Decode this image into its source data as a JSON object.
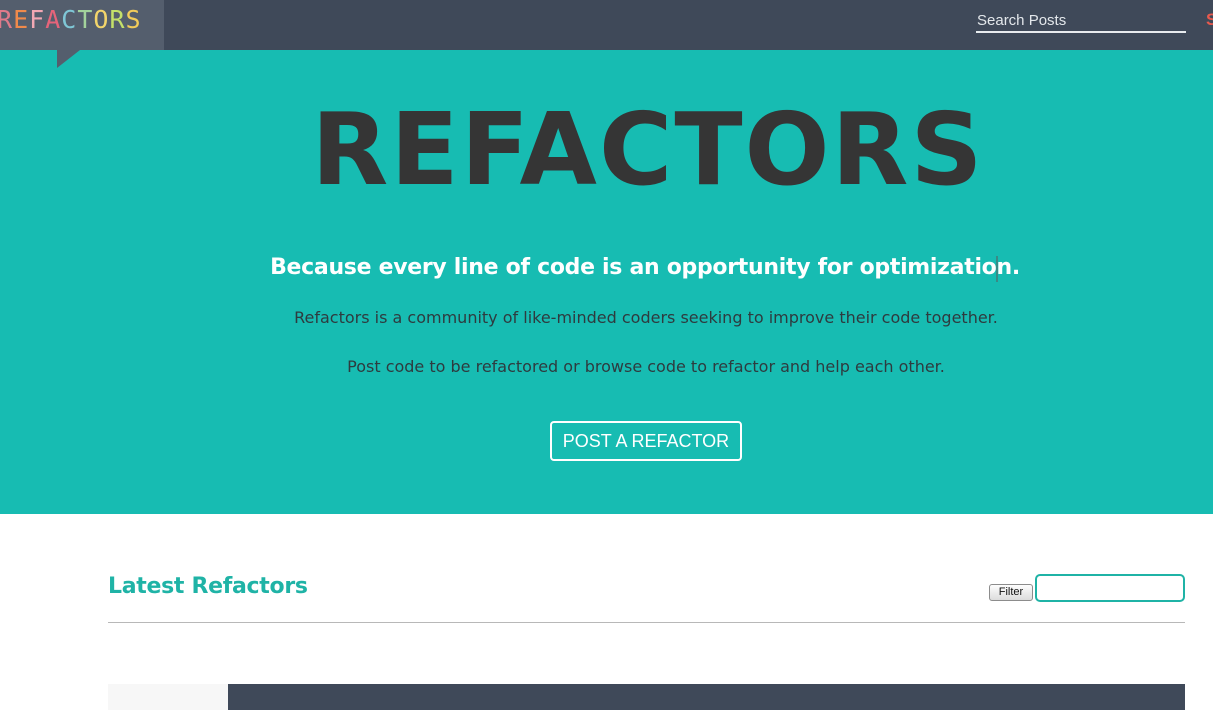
{
  "navbar": {
    "logo_letters": [
      {
        "char": "R",
        "color": "#e07a8a"
      },
      {
        "char": "E",
        "color": "#f08a4b"
      },
      {
        "char": "F",
        "color": "#f2a8b4"
      },
      {
        "char": "A",
        "color": "#e5647a"
      },
      {
        "char": "C",
        "color": "#7fc7d6"
      },
      {
        "char": "T",
        "color": "#a3d39c"
      },
      {
        "char": "O",
        "color": "#f2d56b"
      },
      {
        "char": "R",
        "color": "#c4e06a"
      },
      {
        "char": "S",
        "color": "#f2cc5a"
      }
    ],
    "search_placeholder": "Search Posts",
    "edge_text": "S"
  },
  "hero": {
    "title": "REFACTORS",
    "tagline": "Because every line of code is an opportunity for optimization.",
    "description_1": "Refactors is a community of like-minded coders seeking to improve their code together.",
    "description_2": "Post code to be refactored or browse code to refactor and help each other.",
    "cta_label": "POST A REFACTOR"
  },
  "latest": {
    "title": "Latest Refactors",
    "filter_label": "Filter",
    "filter_value": ""
  },
  "colors": {
    "navbar": "#3f4959",
    "hero": "#17bcb2",
    "accent": "#1fb3a6",
    "title_text": "#353535"
  }
}
